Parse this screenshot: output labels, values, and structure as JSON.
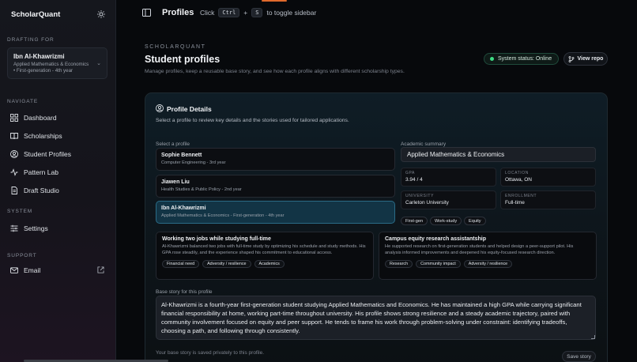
{
  "app": {
    "brand": "ScholarQuant"
  },
  "sidebar": {
    "drafting_label": "DRAFTING FOR",
    "current_profile": {
      "name": "Ibn Al-Khawrizmi",
      "line1": "Applied Mathematics & Economics",
      "line2": "• First-generation - 4th year"
    },
    "navigate_label": "NAVIGATE",
    "nav": [
      {
        "label": "Dashboard",
        "icon": "dashboard-icon"
      },
      {
        "label": "Scholarships",
        "icon": "book-icon"
      },
      {
        "label": "Student Profiles",
        "icon": "user-circle-icon"
      },
      {
        "label": "Pattern Lab",
        "icon": "activity-icon"
      },
      {
        "label": "Draft Studio",
        "icon": "document-icon"
      }
    ],
    "system_label": "SYSTEM",
    "settings_label": "Settings",
    "support_label": "SUPPORT",
    "email_label": "Email"
  },
  "topbar": {
    "title": "Profiles",
    "hint_pre": "Click",
    "key1": "Ctrl",
    "plus": "+",
    "key2": "S",
    "hint_post": "to toggle sidebar"
  },
  "header": {
    "eyebrow": "SCHOLARQUANT",
    "title": "Student profiles",
    "subtitle": "Manage profiles, keep a reusable base story, and see how each profile aligns with different scholarship types.",
    "status": "System status: Online",
    "repo_button": "View repo"
  },
  "panel": {
    "title": "Profile Details",
    "subtitle": "Select a profile to review key details and the stories used for tailored applications.",
    "select_label": "Select a profile",
    "profiles": [
      {
        "name": "Sophie Bennett",
        "detail": "Computer Engineering - 3rd year"
      },
      {
        "name": "Jiawen Liu",
        "detail": "Health Studies & Public Policy - 2nd year"
      },
      {
        "name": "Ibn Al-Khawrizmi",
        "detail": "Applied Mathematics & Economics - First-generation - 4th year"
      }
    ],
    "academic_label": "Academic summary",
    "academic_value": "Applied Mathematics & Economics",
    "stats": {
      "gpa_label": "GPA",
      "gpa": "3.94 / 4",
      "location_label": "LOCATION",
      "location": "Ottawa, ON",
      "university_label": "UNIVERSITY",
      "university": "Carleton University",
      "enrollment_label": "ENROLLMENT",
      "enrollment": "Full-time"
    },
    "chips": [
      "First-gen",
      "Work-study",
      "Equity"
    ],
    "stories": [
      {
        "title": "Working two jobs while studying full-time",
        "body": "Al-Khawrizmi balanced two jobs with full-time study by optimizing his schedule and study methods. His GPA rose steadily, and the experience shaped his commitment to educational access.",
        "tags": [
          "Financial need",
          "Adversity / resilience",
          "Academics"
        ]
      },
      {
        "title": "Campus equity research assistantship",
        "body": "He supported research on first-generation students and helped design a peer-support pilot. His analysis informed improvements and deepened his equity-focused research direction.",
        "tags": [
          "Research",
          "Community impact",
          "Adversity / resilience"
        ]
      }
    ],
    "base_label": "Base story for this profile",
    "base_story": "Al-Khawrizmi is a fourth-year first-generation student studying Applied Mathematics and Economics. He has maintained a high GPA while carrying significant financial responsibility at home, working part-time throughout university. His profile shows strong resilience and a steady academic trajectory, paired with community involvement focused on equity and peer support. He tends to frame his work through problem-solving under constraint: identifying tradeoffs, choosing a path, and following through consistently.",
    "save_note": "Your base story is saved privately to this profile.",
    "save_button": "Save story"
  }
}
